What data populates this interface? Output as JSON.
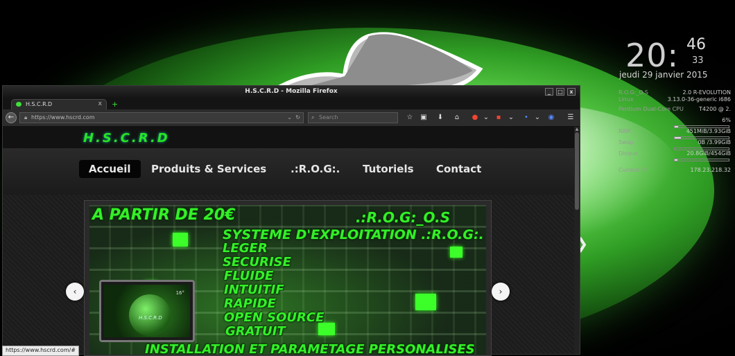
{
  "window": {
    "title": "H.S.C.R.D - Mozilla Firefox",
    "controls": [
      "_",
      "□",
      "x"
    ]
  },
  "tab": {
    "label": "H.S.C.R.D",
    "close": "x",
    "newtab": "+"
  },
  "navbar": {
    "back": "←",
    "url": "https://www.hscrd.com",
    "search_placeholder": "Search",
    "icons": [
      "bookmark-star-icon",
      "reading-list-icon",
      "download-icon",
      "home-icon",
      "addon-red-icon",
      "addon-flag-icon",
      "addon-dot-icon",
      "addon-eye-icon",
      "menu-icon"
    ]
  },
  "site": {
    "logo": "H.S.C.R.D",
    "nav": [
      "Accueil",
      "Produits & Services",
      ".:R.O.G:.",
      "Tutoriels",
      "Contact"
    ],
    "slide": {
      "line1": "A PARTIR DE 20€",
      "line2": ".:R.O.G:_O.S",
      "line3": "SYSTEME D'EXPLOITATION .:R.O.G:.",
      "features": [
        "LEGER",
        "SECURISE",
        "FLUIDE",
        "INTUITIF",
        "RAPIDE",
        "OPEN SOURCE",
        "GRATUIT"
      ],
      "bottom": "INSTALLATION ET PARAMETAGE PERSONALISES",
      "laptop_title": "H.S.C.R.D",
      "laptop_num": "16°"
    },
    "prev": "‹",
    "next": "›"
  },
  "status": {
    "url": "https://www.hscrd.com/#"
  },
  "conky": {
    "hour": "20:",
    "minute": "46",
    "second": "33",
    "date": "jeudi 29 janvier 2015",
    "rows": [
      {
        "k": "R.O.G:_O.S",
        "v": "2.0   R-EVOLUTION"
      },
      {
        "k": "Linux",
        "v": "3.13.0-36-generic i686"
      },
      {
        "k": "Pentium Dual-Core CPU",
        "v": "T4200 @ 2."
      },
      {
        "k": "",
        "v": "6%"
      },
      {
        "k": "RAM",
        "v": "451MiB/3.93GiB"
      },
      {
        "k": "Swap",
        "v": "0B  /3.99GiB"
      },
      {
        "k": "Disque",
        "v": "20.8GiB/454GiB"
      },
      {
        "k": "Current IP:",
        "v": "178.23.218.32"
      }
    ],
    "bars": [
      0.06,
      0.11,
      0.0,
      0.05
    ]
  }
}
